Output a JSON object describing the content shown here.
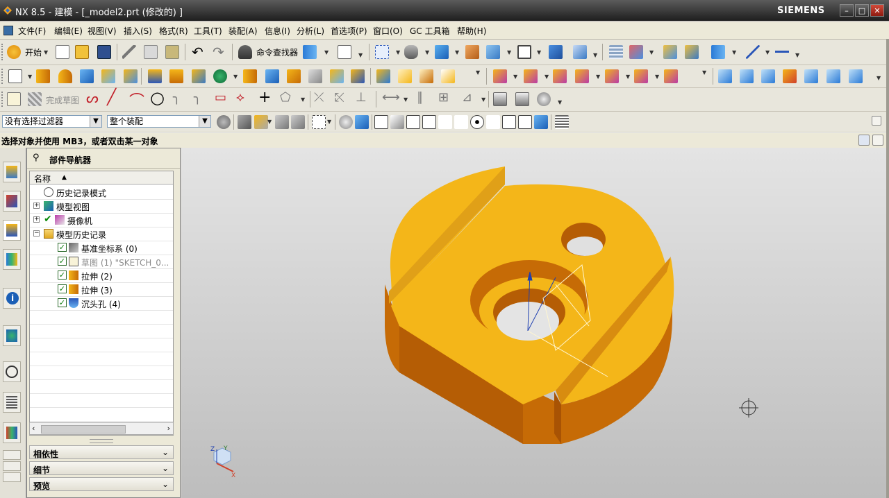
{
  "window": {
    "title": "NX 8.5 - 建模 - [_model2.prt  (修改的) ]",
    "brand": "SIEMENS"
  },
  "menu": {
    "items": [
      "文件(F)",
      "编辑(E)",
      "视图(V)",
      "插入(S)",
      "格式(R)",
      "工具(T)",
      "装配(A)",
      "信息(I)",
      "分析(L)",
      "首选项(P)",
      "窗口(O)",
      "GC 工具箱",
      "帮助(H)"
    ]
  },
  "toolbar1": {
    "start_label": "开始",
    "cmd_finder_label": "命令查找器"
  },
  "toolbar3": {
    "finish_sketch_label": "完成草图"
  },
  "filters": {
    "selection_filter": "没有选择过滤器",
    "scope": "整个装配"
  },
  "status": {
    "prompt": "选择对象并使用 MB3，或者双击某一对象"
  },
  "navigator": {
    "title": "部件导航器",
    "column_name": "名称",
    "rows": [
      {
        "label": "历史记录模式"
      },
      {
        "label": "模型视图"
      },
      {
        "label": "摄像机"
      },
      {
        "label": "模型历史记录"
      },
      {
        "label": "基准坐标系 (0)"
      },
      {
        "label": "草图 (1) \"SKETCH_0..."
      },
      {
        "label": "拉伸 (2)"
      },
      {
        "label": "拉伸 (3)"
      },
      {
        "label": "沉头孔 (4)"
      }
    ],
    "sections": [
      "相依性",
      "细节",
      "预览"
    ]
  },
  "triad": {
    "z": "Z",
    "y": "Y",
    "x": "X"
  },
  "colors": {
    "part_top": "#f4b619",
    "part_side": "#c66b06",
    "accent": "#3a6ea5"
  }
}
